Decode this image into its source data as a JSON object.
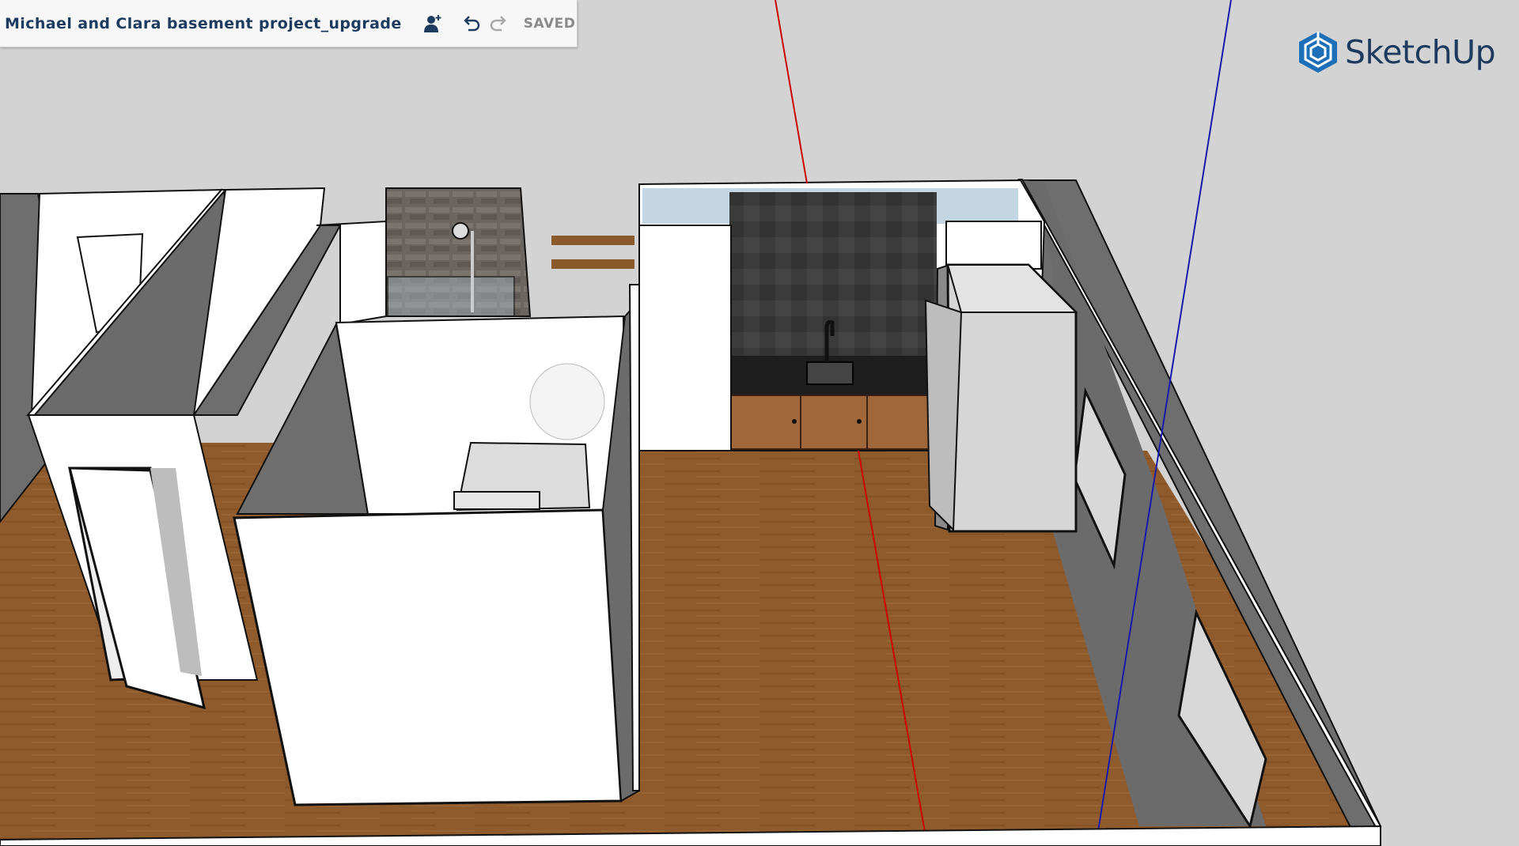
{
  "document": {
    "title": "Michael and Clara basement project_upgrade",
    "save_status": "SAVED"
  },
  "toolbar": {
    "share_icon": "add-collaborator-icon",
    "undo_icon": "undo-icon",
    "redo_icon": "redo-icon"
  },
  "brand": {
    "name": "SketchUp",
    "logo_icon": "sketchup-logo-icon",
    "color": "#1d3b5e"
  },
  "scene": {
    "description_icons": [
      "walls",
      "doors",
      "shower",
      "kitchenette",
      "refrigerator",
      "windows"
    ],
    "colors": {
      "sky": "#d3d3d3",
      "floor": "#8b5a2b",
      "wall_white": "#ffffff",
      "wall_gray": "#6e6e6e",
      "cabinet_wood": "#a0673a",
      "backsplash": "#3a3a3a",
      "red_axis": "#cc0000",
      "blue_axis": "#1a1aaa"
    }
  }
}
